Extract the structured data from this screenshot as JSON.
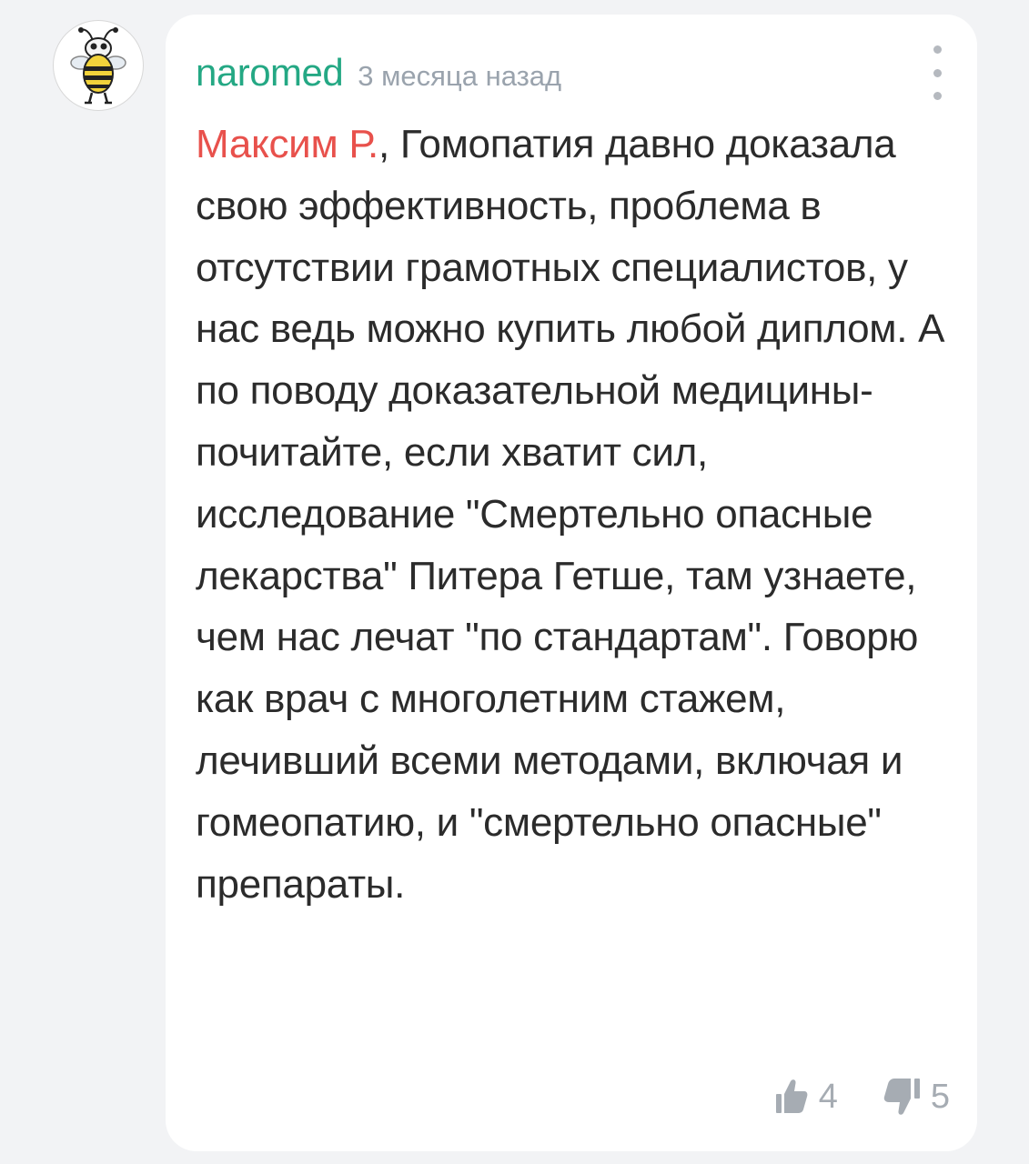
{
  "comment": {
    "author": "naromed",
    "timestamp": "3 месяца назад",
    "reply_to": "Максим Р.",
    "text": ", Гомопатия давно доказала свою эффективность, проблема в отсутствии грамотных специалистов, у нас ведь можно купить любой диплом. А по поводу доказательной медицины- почитайте, если хватит сил, исследование \"Смертельно опасные лекарства\" Питера Гетше, там узнаете, чем нас лечат \"по стандартам\". Говорю как врач с многолетним стажем, лечивший всеми методами, включая и гомеопатию, и \"смертельно опасные\" препараты.",
    "likes": "4",
    "dislikes": "5"
  },
  "icons": {
    "avatar": "bee-cartoon-icon",
    "menu": "more-vertical-icon",
    "like": "thumbs-up-icon",
    "dislike": "thumbs-down-icon"
  },
  "colors": {
    "author": "#24a884",
    "reply_to": "#e8514c",
    "timestamp": "#9aa3ad",
    "text": "#2b2b2b",
    "reaction": "#a6acb3",
    "background": "#f2f3f5",
    "card": "#ffffff"
  }
}
